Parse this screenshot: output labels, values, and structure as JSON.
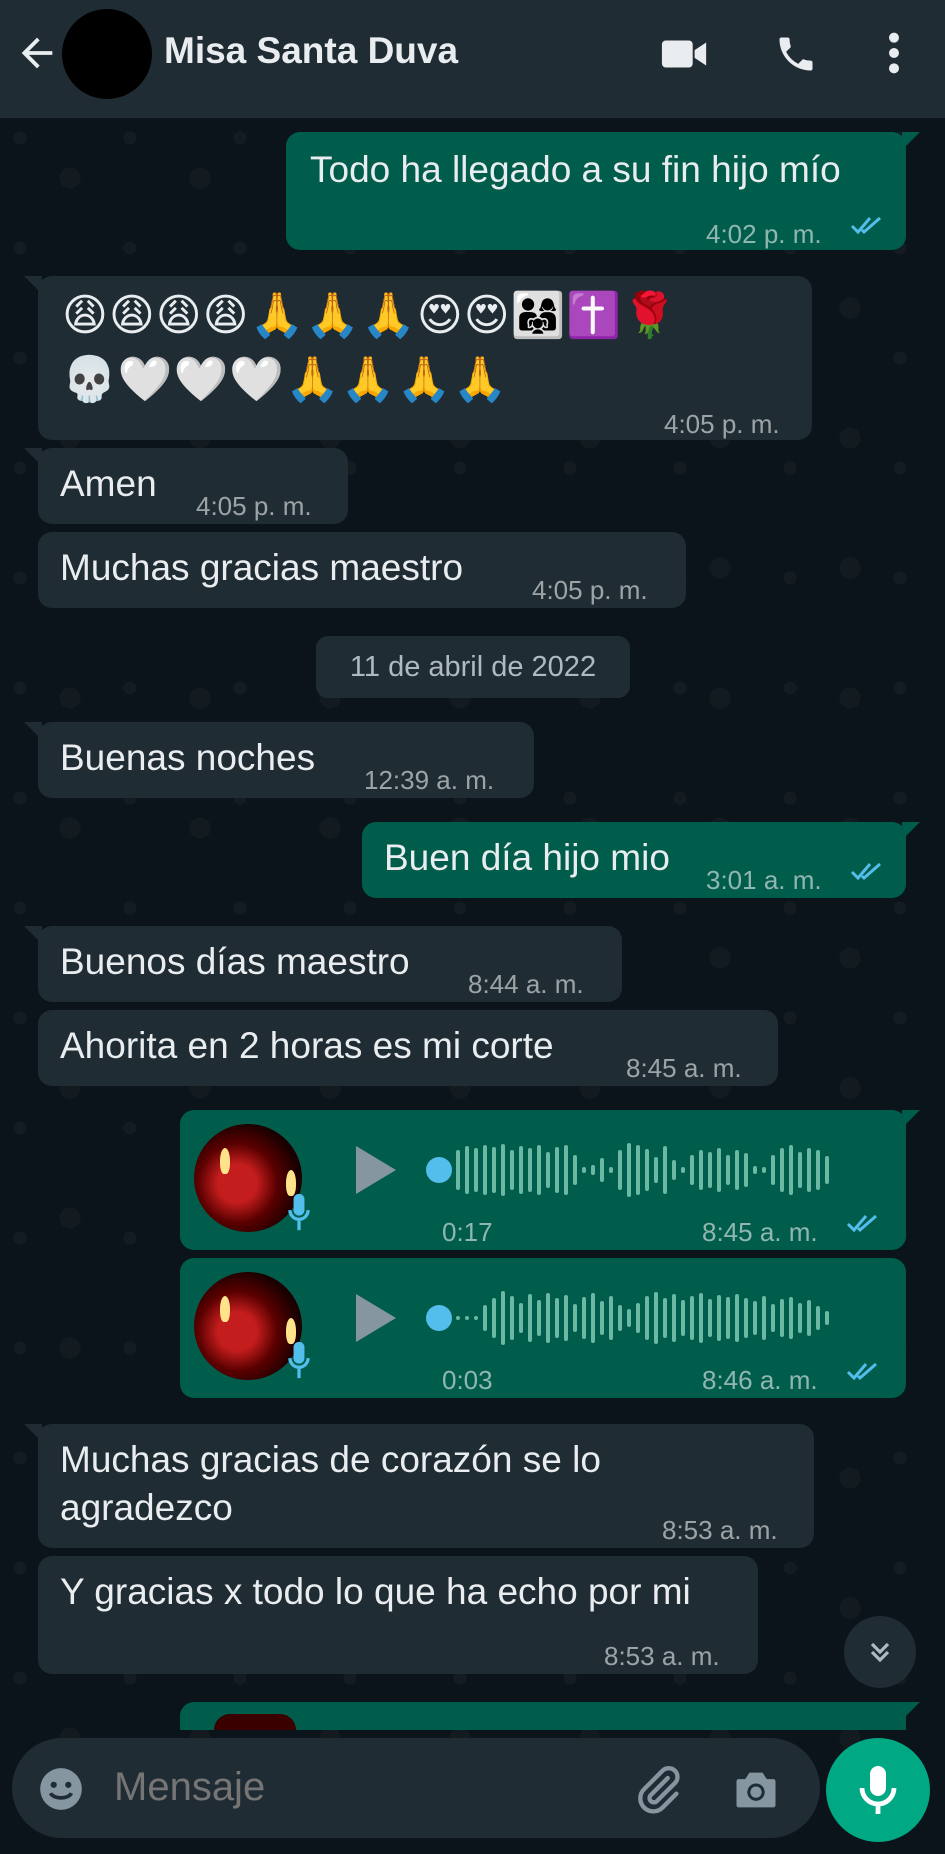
{
  "header": {
    "contact_name": "Misa Santa Duva"
  },
  "messages": [
    {
      "text": "Todo ha llegado a su fin hijo mío",
      "time": "4:02 p. m."
    },
    {
      "emoji_line1": "😩😩😩😩🙏🙏🙏😍😍👨‍👩‍👧✝️🌹",
      "emoji_line2": "💀🤍🤍🤍🙏🙏🙏🙏",
      "time": "4:05 p. m."
    },
    {
      "text": "Amen",
      "time": "4:05 p. m."
    },
    {
      "text": "Muchas gracias maestro",
      "time": "4:05 p. m."
    },
    {
      "text": "Buenas noches",
      "time": "12:39 a. m."
    },
    {
      "text": "Buen día hijo mio",
      "time": "3:01 a. m."
    },
    {
      "text": "Buenos días maestro",
      "time": "8:44 a. m."
    },
    {
      "text": "Ahorita en 2 horas es mi corte",
      "time": "8:45 a. m."
    },
    {
      "duration": "0:17",
      "time": "8:45 a. m."
    },
    {
      "duration": "0:03",
      "time": "8:46 a. m."
    },
    {
      "line1": "Muchas gracias de corazón se lo",
      "line2": "agradezco",
      "time": "8:53 a. m."
    },
    {
      "text": "Y gracias x todo lo que ha echo por mi",
      "time": "8:53 a. m."
    }
  ],
  "date_separator": "11 de abril de 2022",
  "input": {
    "placeholder": "Mensaje"
  },
  "colors": {
    "outgoing": "#005c4b",
    "incoming": "#202c33",
    "accent": "#00a884",
    "read_ticks": "#53bdeb"
  }
}
